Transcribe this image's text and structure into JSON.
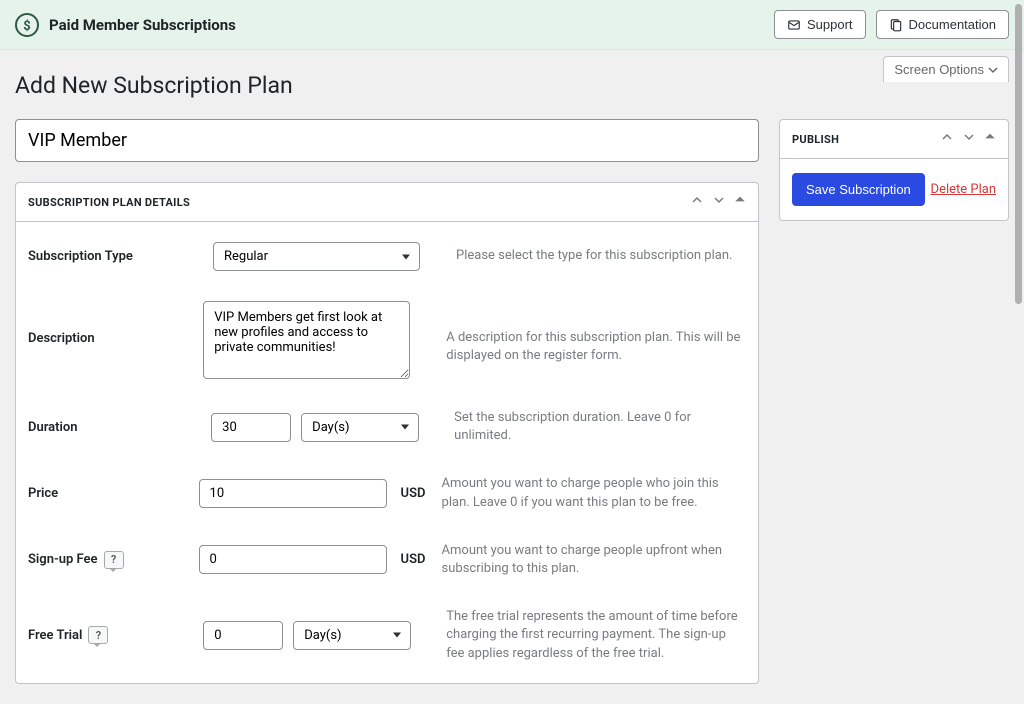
{
  "banner": {
    "title": "Paid Member Subscriptions",
    "support_label": "Support",
    "docs_label": "Documentation"
  },
  "page": {
    "title": "Add New Subscription Plan",
    "screen_options": "Screen Options"
  },
  "form": {
    "plan_title_value": "VIP Member",
    "details_header": "Subscription Plan Details",
    "publish_header": "Publish",
    "save_label": "Save Subscription",
    "delete_label": "Delete Plan",
    "fields": {
      "subscription_type": {
        "label": "Subscription Type",
        "value": "Regular",
        "hint": "Please select the type for this subscription plan."
      },
      "description": {
        "label": "Description",
        "value": "VIP Members get first look at new profiles and access to private communities!",
        "hint": "A description for this subscription plan. This will be displayed on the register form."
      },
      "duration": {
        "label": "Duration",
        "value": "30",
        "unit": "Day(s)",
        "hint": "Set the subscription duration. Leave 0 for unlimited."
      },
      "price": {
        "label": "Price",
        "value": "10",
        "currency": "USD",
        "hint": "Amount you want to charge people who join this plan. Leave 0 if you want this plan to be free."
      },
      "signup_fee": {
        "label": "Sign-up Fee",
        "value": "0",
        "currency": "USD",
        "hint": "Amount you want to charge people upfront when subscribing to this plan."
      },
      "free_trial": {
        "label": "Free Trial",
        "value": "0",
        "unit": "Day(s)",
        "hint": "The free trial represents the amount of time before charging the first recurring payment. The sign-up fee applies regardless of the free trial."
      }
    }
  }
}
